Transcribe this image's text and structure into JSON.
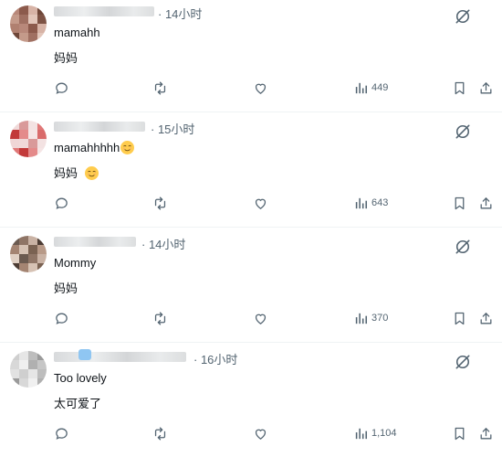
{
  "posts": [
    {
      "time": "· 14小时",
      "text_en": "mamahh",
      "text_cn": "妈妈",
      "views": "449",
      "text_en_emoji": false,
      "text_cn_emoji": false,
      "avatar_colors": [
        "#b8887a",
        "#8c5a4c",
        "#d7b3a6",
        "#6e4638",
        "#c49a8a",
        "#a07062",
        "#e2c6ba",
        "#7d5244",
        "#b08070"
      ]
    },
    {
      "time": "· 15小时",
      "text_en": "mamahhhhh",
      "text_cn": "妈妈",
      "views": "643",
      "text_en_emoji": true,
      "text_cn_emoji": true,
      "avatar_colors": [
        "#f0d9d9",
        "#d99a9a",
        "#f3e2e2",
        "#e07878",
        "#c23a3a",
        "#e48a8a",
        "#f5e5e5",
        "#d96b6b",
        "#f0d6d6"
      ]
    },
    {
      "time": "· 14小时",
      "text_en": "Mommy",
      "text_cn": "妈妈",
      "views": "370",
      "text_en_emoji": false,
      "text_cn_emoji": false,
      "avatar_colors": [
        "#6b5a50",
        "#8f7566",
        "#c9b2a4",
        "#4c3c34",
        "#a48472",
        "#d6c2b4",
        "#7a6252",
        "#b89a88",
        "#e0d0c4"
      ]
    },
    {
      "time": "· 16小时",
      "text_en": "Too lovely",
      "text_cn": "太可爱了",
      "views": "1,104",
      "text_en_emoji": false,
      "text_cn_emoji": false,
      "avatar_colors": [
        "#cfcfcf",
        "#e6e6e6",
        "#bdbdbd",
        "#9a9a9a",
        "#d8d8d8",
        "#f0f0f0",
        "#b0b0b0",
        "#c6c6c6",
        "#e2e2e2"
      ]
    }
  ],
  "icons": {
    "reply": "reply-icon",
    "repost": "repost-icon",
    "like": "like-icon",
    "views": "views-icon",
    "bookmark": "bookmark-icon",
    "share": "share-icon",
    "grok": "grok-icon",
    "emoji": "relieved-face-emoji"
  }
}
